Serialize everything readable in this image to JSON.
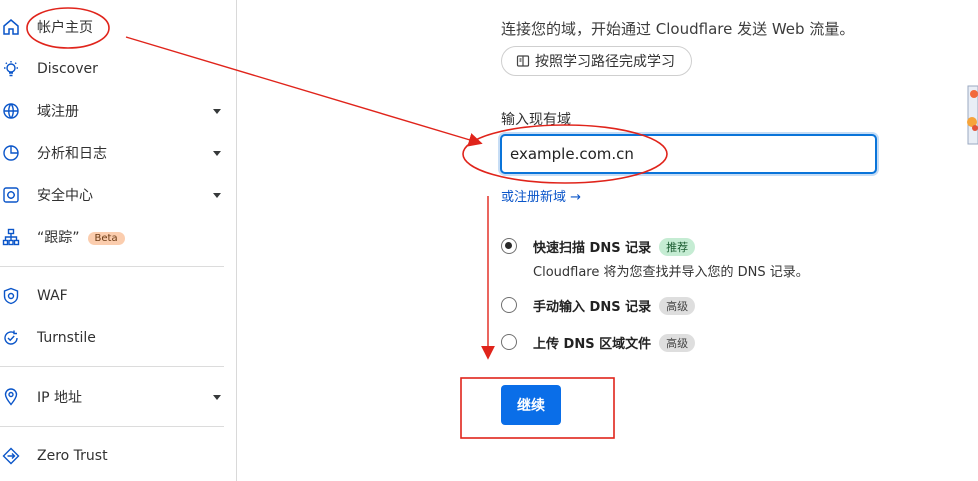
{
  "sidebar": {
    "items": [
      {
        "label": "帐户主页",
        "icon": "home-icon",
        "caret": false
      },
      {
        "label": "Discover",
        "icon": "lightbulb-icon",
        "caret": false
      },
      {
        "label": "域注册",
        "icon": "globe-icon",
        "caret": true
      },
      {
        "label": "分析和日志",
        "icon": "pie-chart-icon",
        "caret": true
      },
      {
        "label": "安全中心",
        "icon": "security-center-icon",
        "caret": true
      },
      {
        "label": "“跟踪”",
        "icon": "sitemap-icon",
        "caret": false,
        "badge": "Beta"
      },
      {
        "label": "WAF",
        "icon": "shield-gear-icon",
        "caret": false
      },
      {
        "label": "Turnstile",
        "icon": "turnstile-icon",
        "caret": false
      },
      {
        "label": "IP 地址",
        "icon": "location-pin-icon",
        "caret": true
      },
      {
        "label": "Zero Trust",
        "icon": "zero-trust-icon",
        "caret": false
      }
    ]
  },
  "main": {
    "subtitle": "连接您的域，开始通过 Cloudflare 发送 Web 流量。",
    "path_button": "按照学习路径完成学习",
    "field_label": "输入现有域",
    "domain_value": "example.com.cn",
    "register_link": "或注册新域 →",
    "options": [
      {
        "label": "快速扫描 DNS 记录",
        "tag": "推荐",
        "tag_style": "green",
        "checked": true
      },
      {
        "label": "手动输入 DNS 记录",
        "tag": "高级",
        "tag_style": "gray",
        "checked": false
      },
      {
        "label": "上传 DNS 区域文件",
        "tag": "高级",
        "tag_style": "gray",
        "checked": false
      }
    ],
    "option_desc": "Cloudflare 将为您查找并导入您的 DNS 记录。",
    "continue_label": "继续"
  },
  "colors": {
    "accent": "#0a6ee8",
    "link": "#0a55c9",
    "annotation": "#e0241b"
  }
}
